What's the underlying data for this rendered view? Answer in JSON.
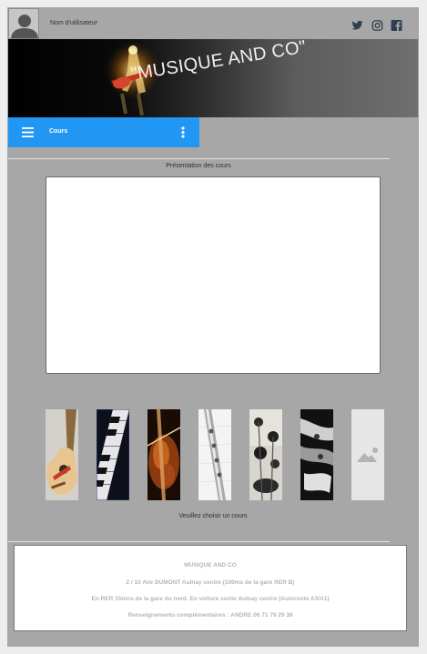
{
  "header": {
    "username": "Nom d'utilisateur",
    "avatar_icon": "user-avatar-icon",
    "social": [
      {
        "icon": "twitter-icon"
      },
      {
        "icon": "instagram-icon"
      },
      {
        "icon": "facebook-icon"
      }
    ]
  },
  "banner": {
    "title": "\"MUSIQUE AND CO\""
  },
  "navbar": {
    "title": "Cours",
    "color": "#2196f3"
  },
  "courses": {
    "heading": "Présentation des cours",
    "prompt": "Veuillez choisir un cours",
    "thumbnails": [
      {
        "icon": "guitar-image"
      },
      {
        "icon": "piano-image"
      },
      {
        "icon": "violin-image"
      },
      {
        "icon": "flute-image"
      },
      {
        "icon": "drums-image"
      },
      {
        "icon": "saxophone-image"
      },
      {
        "icon": "image-placeholder-icon"
      }
    ]
  },
  "footer": {
    "name": "MUSIQUE AND CO",
    "address": "2 / 10  Ave DUMONT Aulnay centre (100ms de la gare RER B)",
    "directions": "En RER 15mns de la gare du nord. En voiture  sortie Aulnay centre (Autoroute A3/A1)",
    "contact": "Renseignements complémentaires : ANDRE 06 71 79 29 38"
  }
}
